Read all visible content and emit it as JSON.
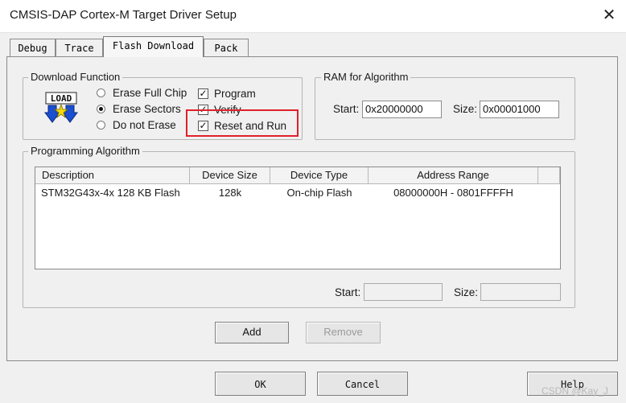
{
  "window": {
    "title": "CMSIS-DAP Cortex-M Target Driver Setup",
    "close_glyph": "✕"
  },
  "tabs": [
    {
      "label": "Debug"
    },
    {
      "label": "Trace"
    },
    {
      "label": "Flash Download"
    },
    {
      "label": "Pack"
    }
  ],
  "download_function": {
    "legend": "Download Function",
    "icon_text": "LOAD",
    "erase_full_chip": "Erase Full Chip",
    "erase_sectors": "Erase Sectors",
    "do_not_erase": "Do not Erase",
    "program": "Program",
    "verify": "Verify",
    "reset_and_run": "Reset and Run",
    "selected_erase": "Erase Sectors",
    "program_checked": true,
    "verify_checked": true,
    "reset_and_run_checked": true
  },
  "ram_for_algorithm": {
    "legend": "RAM for Algorithm",
    "start_label": "Start:",
    "start_value": "0x20000000",
    "size_label": "Size:",
    "size_value": "0x00001000"
  },
  "programming_algorithm": {
    "legend": "Programming Algorithm",
    "columns": [
      "Description",
      "Device Size",
      "Device Type",
      "Address Range"
    ],
    "rows": [
      {
        "description": "STM32G43x-4x 128 KB Flash",
        "device_size": "128k",
        "device_type": "On-chip Flash",
        "address_range": "08000000H - 0801FFFFH"
      }
    ],
    "start_label": "Start:",
    "start_value": "",
    "size_label": "Size:",
    "size_value": ""
  },
  "buttons": {
    "add": "Add",
    "remove": "Remove",
    "ok": "OK",
    "cancel": "Cancel",
    "help": "Help"
  },
  "watermark": "CSDN @Kay_J",
  "colors": {
    "highlight": "#e0202a",
    "load_icon_arrow": "#1a4fd0",
    "load_icon_star": "#f5d90a"
  }
}
